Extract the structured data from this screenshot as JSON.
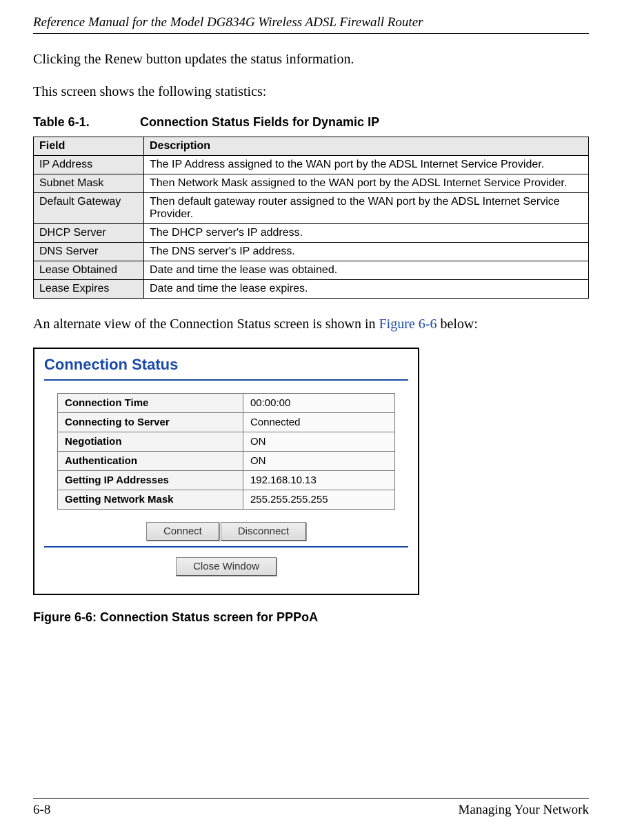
{
  "header": {
    "title": "Reference Manual for the Model DG834G Wireless ADSL Firewall Router"
  },
  "body": {
    "p1": "Clicking the Renew button updates the status information.",
    "p2": "This screen shows the following statistics:",
    "p3_a": "An alternate view of the Connection Status screen is shown in ",
    "p3_link": "Figure 6-6",
    "p3_b": " below:"
  },
  "table": {
    "caption_label": "Table 6-1.",
    "caption_text": "Connection Status Fields for Dynamic IP",
    "headers": {
      "field": "Field",
      "description": "Description"
    },
    "rows": [
      {
        "field": "IP Address",
        "description": "The IP Address assigned to the WAN port by the ADSL Internet Service Provider."
      },
      {
        "field": "Subnet Mask",
        "description": "Then Network Mask assigned to the WAN port by the ADSL Internet Service Provider."
      },
      {
        "field": "Default Gateway",
        "description": "Then default gateway router assigned to the WAN port by the ADSL Internet Service Provider."
      },
      {
        "field": "DHCP Server",
        "description": "The DHCP server's IP address."
      },
      {
        "field": "DNS Server",
        "description": "The DNS server's IP address."
      },
      {
        "field": "Lease Obtained",
        "description": "Date and time the lease was obtained."
      },
      {
        "field": "Lease Expires",
        "description": "Date and time the lease expires."
      }
    ]
  },
  "figure": {
    "title": "Connection Status",
    "rows": [
      {
        "label": "Connection Time",
        "value": "00:00:00"
      },
      {
        "label": "Connecting to Server",
        "value": "Connected"
      },
      {
        "label": "Negotiation",
        "value": "ON"
      },
      {
        "label": "Authentication",
        "value": "ON"
      },
      {
        "label": "Getting IP Addresses",
        "value": "192.168.10.13"
      },
      {
        "label": "Getting Network Mask",
        "value": "255.255.255.255"
      }
    ],
    "buttons": {
      "connect": "Connect",
      "disconnect": "Disconnect",
      "close": "Close Window"
    },
    "caption": "Figure 6-6:  Connection Status screen for PPPoA"
  },
  "footer": {
    "page": "6-8",
    "section": "Managing Your Network"
  }
}
